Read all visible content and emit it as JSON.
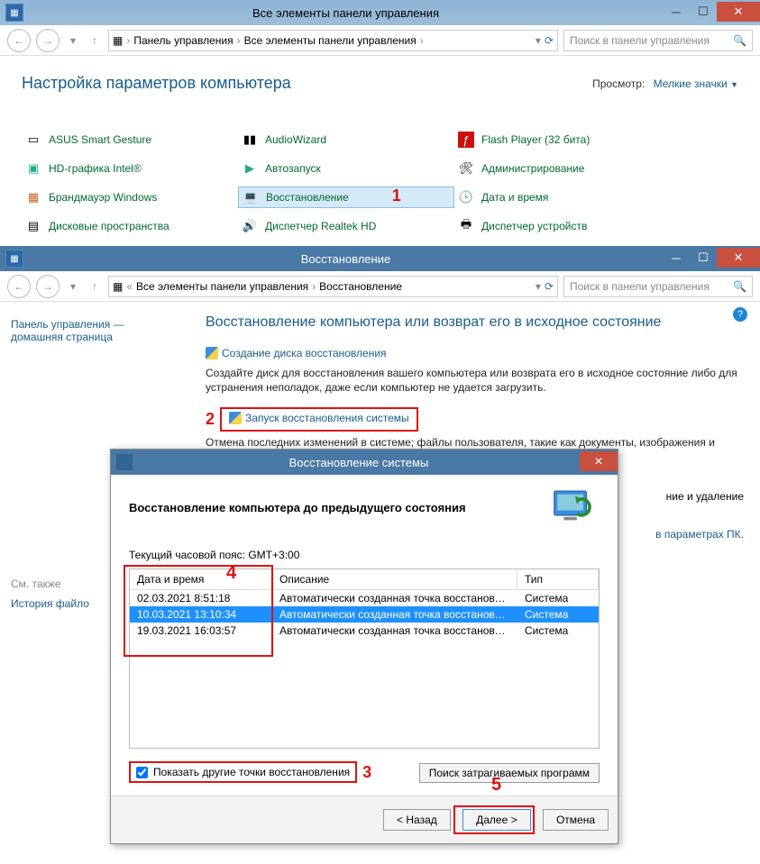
{
  "window1": {
    "title": "Все элементы панели управления",
    "nav": {
      "crumb1": "Панель управления",
      "crumb2": "Все элементы панели управления",
      "search_ph": "Поиск в панели управления"
    },
    "page_title": "Настройка параметров компьютера",
    "view_label": "Просмотр:",
    "view_value": "Мелкие значки",
    "items": {
      "c0r0": "ASUS Smart Gesture",
      "c1r0": "AudioWizard",
      "c2r0": "Flash Player (32 бита)",
      "c0r1": "HD-графика Intel®",
      "c1r1": "Автозапуск",
      "c2r1": "Администрирование",
      "c0r2": "Брандмауэр Windows",
      "c1r2": "Восстановление",
      "c2r2": "Дата и время",
      "c0r3": "Дисковые пространства",
      "c1r3": "Диспетчер Realtek HD",
      "c2r3": "Диспетчер устройств"
    },
    "annotation": {
      "n1": "1"
    }
  },
  "window2": {
    "title": "Восстановление",
    "nav": {
      "crumb1": "Все элементы панели управления",
      "crumb2": "Восстановление",
      "search_ph": "Поиск в панели управления"
    },
    "sidebar": {
      "hdr1": "Панель управления —",
      "hdr2": "домашняя страница",
      "see_also": "См. также",
      "history": "История файло"
    },
    "main": {
      "h2": "Восстановление компьютера или возврат его в исходное состояние",
      "link1": "Создание диска восстановления",
      "desc1": "Создайте диск для восстановления вашего компьютера или возврата его в исходное состояние либо для устранения неполадок, даже если компьютер не удается загрузить.",
      "link2": "Запуск восстановления системы",
      "desc2": "Отмена последних изменений в системе; файлы пользователя, такие как документы, изображения и музыка, остаются без изменений.",
      "tail1": "ние и удаление",
      "tail2": "в параметрах ПК."
    },
    "annotation": {
      "n2": "2"
    }
  },
  "dialog": {
    "title": "Восстановление системы",
    "heading": "Восстановление компьютера до предыдущего состояния",
    "tz": "Текущий часовой пояс: GMT+3:00",
    "cols": {
      "c1": "Дата и время",
      "c2": "Описание",
      "c3": "Тип"
    },
    "rows": [
      {
        "date": "02.03.2021 8:51:18",
        "desc": "Автоматически созданная точка восстановле...",
        "type": "Система"
      },
      {
        "date": "10.03.2021 13:10:34",
        "desc": "Автоматически созданная точка восстановле...",
        "type": "Система"
      },
      {
        "date": "19.03.2021 16:03:57",
        "desc": "Автоматически созданная точка восстановле...",
        "type": "Система"
      }
    ],
    "checkbox": "Показать другие точки восстановления",
    "affected_btn": "Поиск затрагиваемых программ",
    "back": "< Назад",
    "next": "Далее >",
    "cancel": "Отмена",
    "annotation": {
      "n3": "3",
      "n4": "4",
      "n5": "5"
    }
  }
}
